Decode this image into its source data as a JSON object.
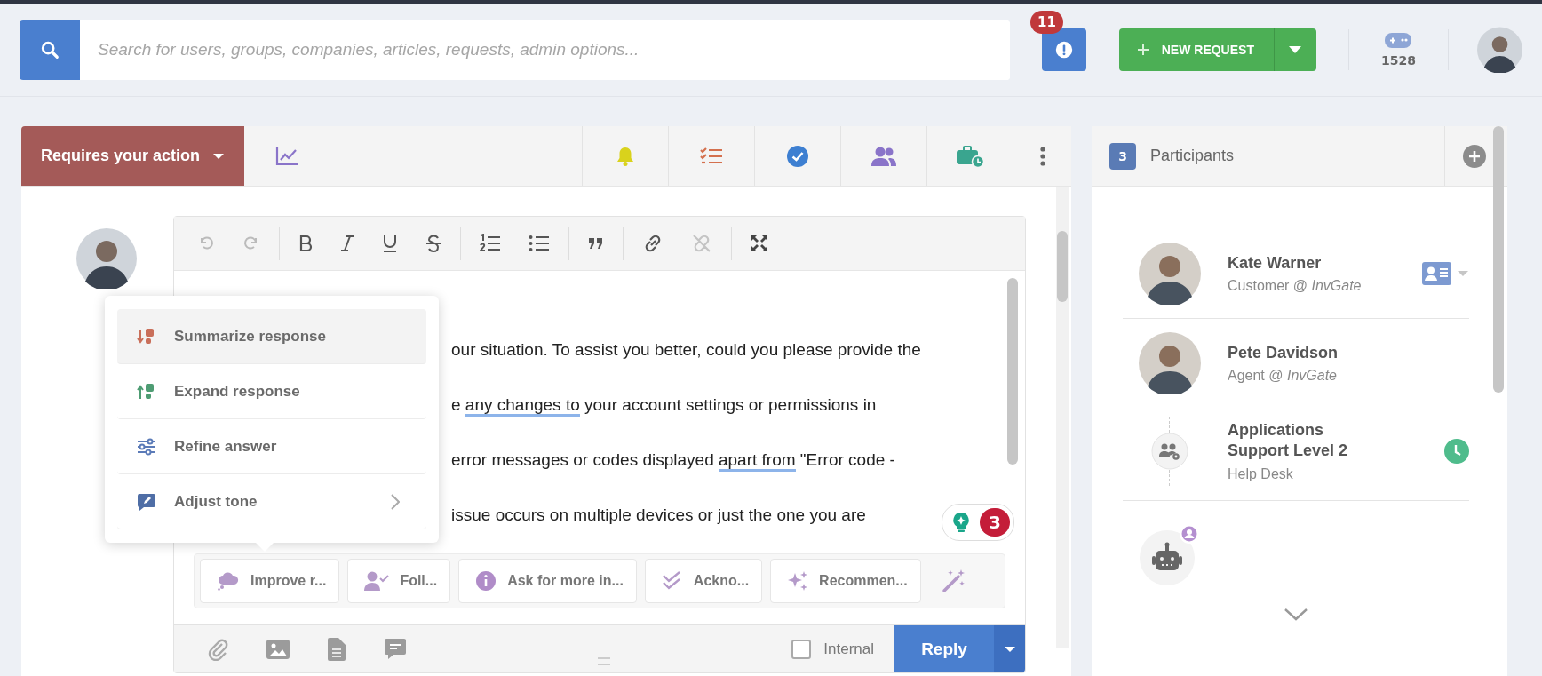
{
  "search": {
    "placeholder": "Search for users, groups, companies, articles, requests, admin options..."
  },
  "alerts": {
    "count": "11"
  },
  "new_request": {
    "label": "NEW REQUEST"
  },
  "points": "1528",
  "toolbar": {
    "status": "Requires your action"
  },
  "editor": {
    "lines": [
      {
        "segments": [
          {
            "text": "our situation. To assist you better, could you please provide the",
            "flagged": false
          }
        ]
      },
      {
        "segments": [
          {
            "text": "e ",
            "flagged": false
          },
          {
            "text": "any changes to",
            "flagged": true
          },
          {
            "text": " your account settings or permissions in",
            "flagged": false
          }
        ]
      },
      {
        "segments": [
          {
            "text": "error messages or codes displayed ",
            "flagged": false
          },
          {
            "text": "apart from",
            "flagged": true
          },
          {
            "text": " \"Error code -",
            "flagged": false
          }
        ]
      },
      {
        "segments": [
          {
            "text": "issue occurs on multiple devices or just the one you are",
            "flagged": false
          }
        ]
      }
    ],
    "ai_menu": [
      {
        "label": "Summarize response",
        "selected": true,
        "submenu": false
      },
      {
        "label": "Expand response",
        "selected": false,
        "submenu": false
      },
      {
        "label": "Refine answer",
        "selected": false,
        "submenu": false
      },
      {
        "label": "Adjust tone",
        "selected": false,
        "submenu": true
      }
    ],
    "ai_badge": "3",
    "quick_actions": [
      "Improve r...",
      "Foll...",
      "Ask for more in...",
      "Ackno...",
      "Recommen..."
    ],
    "internal": {
      "label": "Internal",
      "checked": false
    },
    "reply": "Reply"
  },
  "participants": {
    "count": "3",
    "title": "Participants",
    "members": [
      {
        "kind": "person",
        "name": "Kate Warner",
        "role": "Customer @ *InvGate*"
      },
      {
        "kind": "person",
        "name": "Pete Davidson",
        "role": "Agent @ *InvGate*"
      },
      {
        "kind": "group",
        "name": "Applications Support Level 2",
        "role": "Help Desk"
      },
      {
        "kind": "bot"
      }
    ]
  }
}
